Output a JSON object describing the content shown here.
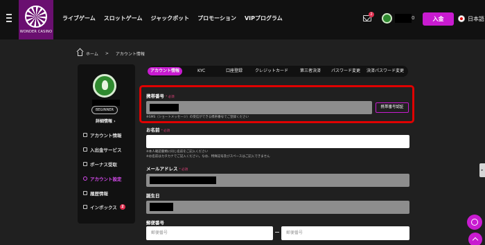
{
  "header": {
    "logo_text": "WONDER CASINO",
    "nav": [
      "ライブゲーム",
      "スロットゲーム",
      "ジャックポット",
      "プロモーション",
      "VIPプログラム"
    ],
    "mail_badge": "2",
    "balance": "0",
    "deposit_label": "入金",
    "language": "日本語"
  },
  "breadcrumb": {
    "home": "ホーム",
    "separator": ">",
    "current": "アカウント情報"
  },
  "sidebar": {
    "rank": "BEGINNER",
    "detail_label": "詳細情報",
    "detail_arrow": "›",
    "items": [
      {
        "label": "アカウント情報",
        "icon": "user-icon"
      },
      {
        "label": "入出金サービス",
        "icon": "wallet-icon"
      },
      {
        "label": "ボーナス受取",
        "icon": "gift-icon"
      },
      {
        "label": "アカウント設定",
        "icon": "settings-icon",
        "active": true
      },
      {
        "label": "履歴情報",
        "icon": "history-icon"
      },
      {
        "label": "インボックス",
        "icon": "mail-icon",
        "badge": "2"
      }
    ]
  },
  "tabs": [
    "アカウント情報",
    "KYC",
    "口座登録",
    "クレジットカード",
    "第三者決済",
    "パスワード変更",
    "決済パスワード変更"
  ],
  "form": {
    "required_mark": "* 必須",
    "phone_label": "携帯番号",
    "verify_button": "携帯番号認証",
    "phone_note": "※SMS（ショートメッセージ）の受信ができる携帯番号でご登録ください",
    "name_label": "お名前",
    "name_note_1": "※本人確認書類に同じ名前をご記入ください",
    "name_note_2": "※お名前はカタカナでご記入ください。なお、特殊記号及びスペースはご記入できません",
    "email_label": "メールアドレス",
    "birthday_label": "誕生日",
    "zip_label": "郵便番号",
    "zip_placeholder_1": "郵便番号",
    "zip_placeholder_2": "郵便番号",
    "zip_separator": "-"
  },
  "colors": {
    "accent": "#c81bd0",
    "highlight": "#e00000",
    "background": "#202020"
  }
}
